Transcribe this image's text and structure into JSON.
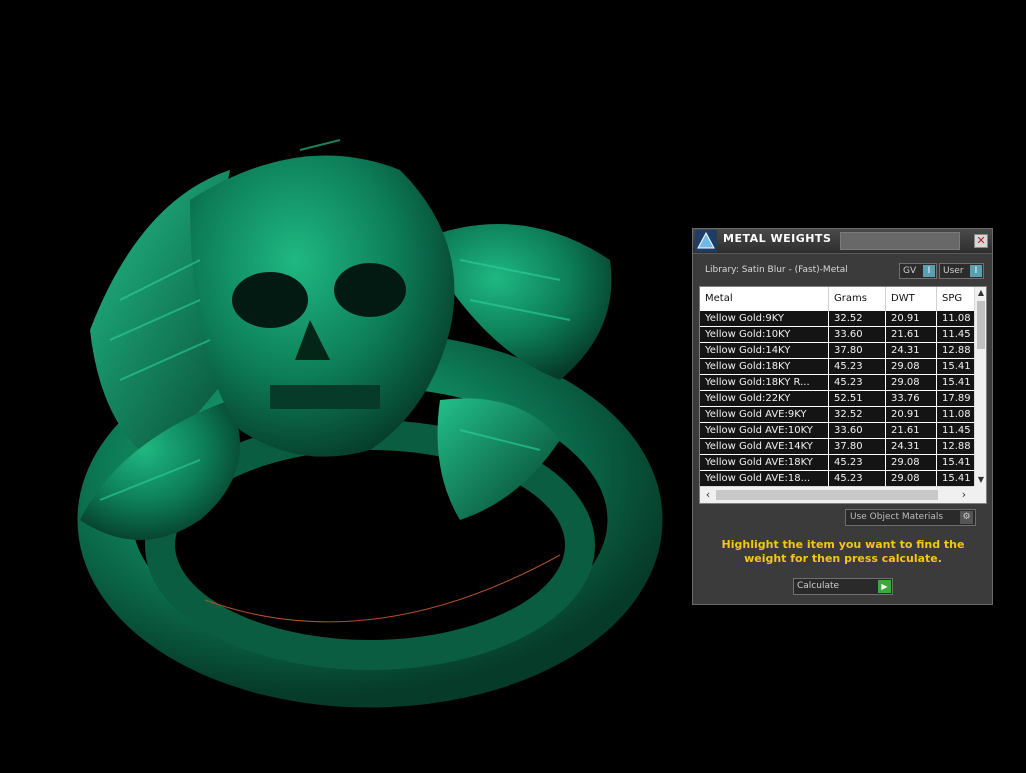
{
  "panel": {
    "title": "METAL WEIGHTS",
    "close_glyph": "✕",
    "library_label": "Library: Satin Blur - (Fast)-Metal",
    "toggles": [
      {
        "label": "GV",
        "state": "I"
      },
      {
        "label": "User",
        "state": "I"
      }
    ],
    "table": {
      "columns": [
        "Metal",
        "Grams",
        "DWT",
        "SPG"
      ],
      "rows": [
        [
          "Yellow Gold:9KY",
          "32.52",
          "20.91",
          "11.08"
        ],
        [
          "Yellow Gold:10KY",
          "33.60",
          "21.61",
          "11.45"
        ],
        [
          "Yellow Gold:14KY",
          "37.80",
          "24.31",
          "12.88"
        ],
        [
          "Yellow Gold:18KY",
          "45.23",
          "29.08",
          "15.41"
        ],
        [
          "Yellow Gold:18KY R...",
          "45.23",
          "29.08",
          "15.41"
        ],
        [
          "Yellow Gold:22KY",
          "52.51",
          "33.76",
          "17.89"
        ],
        [
          "Yellow Gold AVE:9KY",
          "32.52",
          "20.91",
          "11.08"
        ],
        [
          "Yellow Gold AVE:10KY",
          "33.60",
          "21.61",
          "11.45"
        ],
        [
          "Yellow Gold AVE:14KY",
          "37.80",
          "24.31",
          "12.88"
        ],
        [
          "Yellow Gold AVE:18KY",
          "45.23",
          "29.08",
          "15.41"
        ],
        [
          "Yellow Gold AVE:18...",
          "45.23",
          "29.08",
          "15.41"
        ]
      ]
    },
    "materials_select": "Use Object Materials",
    "instruction": "Highlight the item you want to find the weight for then press calculate.",
    "calculate_label": "Calculate",
    "colors": {
      "panel_bg": "#3b3b3b",
      "row_bg": "#141414",
      "instruction": "#f5c518",
      "model_green": "#0f8a63",
      "toggle_knob": "#5aa0b0",
      "go_button": "#3da83d"
    }
  },
  "icons": {
    "app": "teal-pyramid-icon",
    "close": "close-icon",
    "settings": "gear-icon",
    "go": "play-arrow-icon"
  }
}
